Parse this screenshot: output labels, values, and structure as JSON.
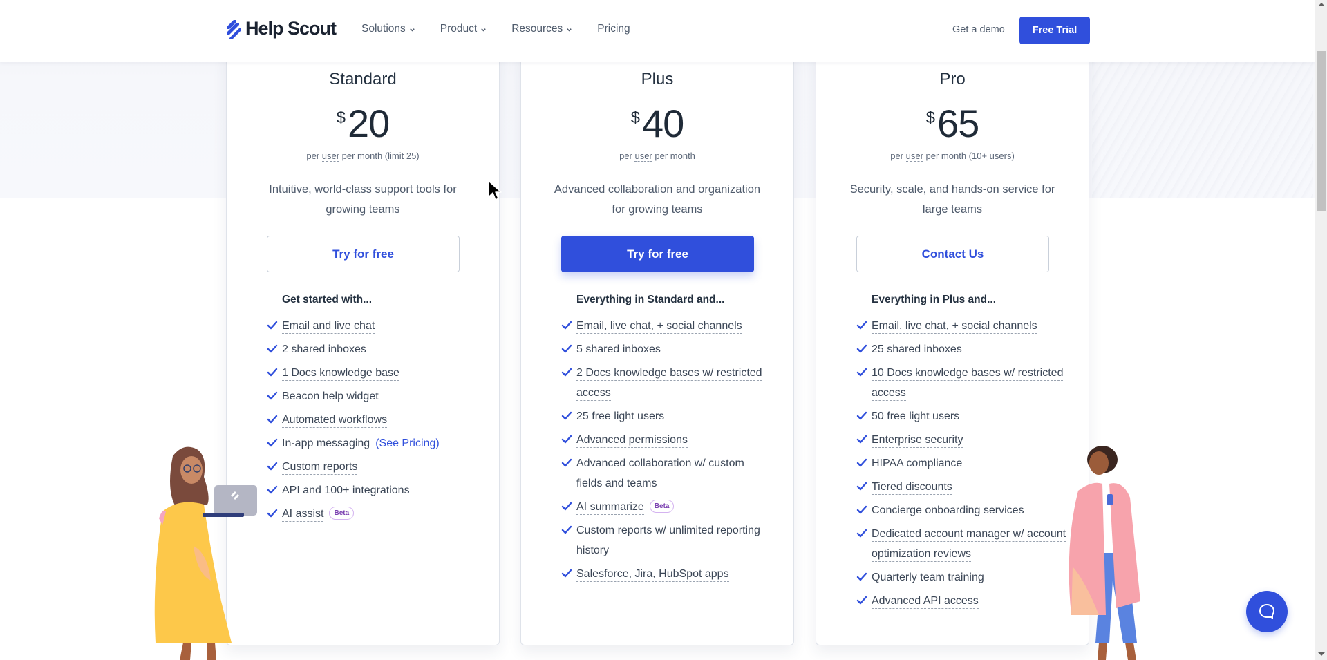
{
  "header": {
    "brand": "Help Scout",
    "nav": [
      {
        "label": "Solutions",
        "has_dropdown": true
      },
      {
        "label": "Product",
        "has_dropdown": true
      },
      {
        "label": "Resources",
        "has_dropdown": true
      },
      {
        "label": "Pricing",
        "has_dropdown": false
      }
    ],
    "get_demo": "Get a demo",
    "free_trial": "Free Trial"
  },
  "colors": {
    "accent": "#304fdc",
    "text_dark": "#1f2a37",
    "text_muted": "#4f5b6c",
    "beta_text": "#7a3fb0",
    "beta_border": "#d4b3f0"
  },
  "plans": [
    {
      "name": "Standard",
      "currency": "$",
      "price": "20",
      "per_prefix": "per ",
      "per_user": "user",
      "per_suffix": " per month (limit 25)",
      "description": "Intuitive, world-class support tools for growing teams",
      "cta": "Try for free",
      "cta_style": "outline",
      "features_heading": "Get started with...",
      "features": [
        {
          "text": "Email and live chat"
        },
        {
          "text": "2 shared inboxes"
        },
        {
          "text": "1 Docs knowledge base"
        },
        {
          "text": "Beacon help widget"
        },
        {
          "text": "Automated workflows"
        },
        {
          "text": "In-app messaging",
          "link": "(See Pricing)"
        },
        {
          "text": "Custom reports"
        },
        {
          "text": "API and 100+ integrations"
        },
        {
          "text": "AI assist",
          "badge": "Beta"
        }
      ]
    },
    {
      "name": "Plus",
      "currency": "$",
      "price": "40",
      "per_prefix": "per ",
      "per_user": "user",
      "per_suffix": " per month",
      "description": "Advanced collaboration and organization for growing teams",
      "cta": "Try for free",
      "cta_style": "solid",
      "features_heading": "Everything in Standard and...",
      "features": [
        {
          "text": "Email, live chat, + social channels"
        },
        {
          "text": "5 shared inboxes"
        },
        {
          "text": "2 Docs knowledge bases w/ restricted access"
        },
        {
          "text": "25 free light users"
        },
        {
          "text": "Advanced permissions"
        },
        {
          "text": "Advanced collaboration w/ custom fields and teams"
        },
        {
          "text": "AI summarize",
          "badge": "Beta"
        },
        {
          "text": "Custom reports w/ unlimited reporting history"
        },
        {
          "text": "Salesforce, Jira, HubSpot apps"
        }
      ]
    },
    {
      "name": "Pro",
      "currency": "$",
      "price": "65",
      "per_prefix": "per ",
      "per_user": "user",
      "per_suffix": " per month (10+ users)",
      "description": "Security, scale, and hands-on service for large teams",
      "cta": "Contact Us",
      "cta_style": "outline",
      "features_heading": "Everything in Plus and...",
      "features": [
        {
          "text": "Email, live chat, + social channels"
        },
        {
          "text": "25 shared inboxes"
        },
        {
          "text": "10 Docs knowledge bases w/ restricted access"
        },
        {
          "text": "50 free light users"
        },
        {
          "text": "Enterprise security"
        },
        {
          "text": "HIPAA compliance"
        },
        {
          "text": "Tiered discounts"
        },
        {
          "text": "Concierge onboarding services"
        },
        {
          "text": "Dedicated account manager w/ account optimization reviews"
        },
        {
          "text": "Quarterly team training"
        },
        {
          "text": "Advanced API access"
        }
      ]
    }
  ],
  "chat_widget": {
    "icon": "chat-bubble-icon"
  }
}
